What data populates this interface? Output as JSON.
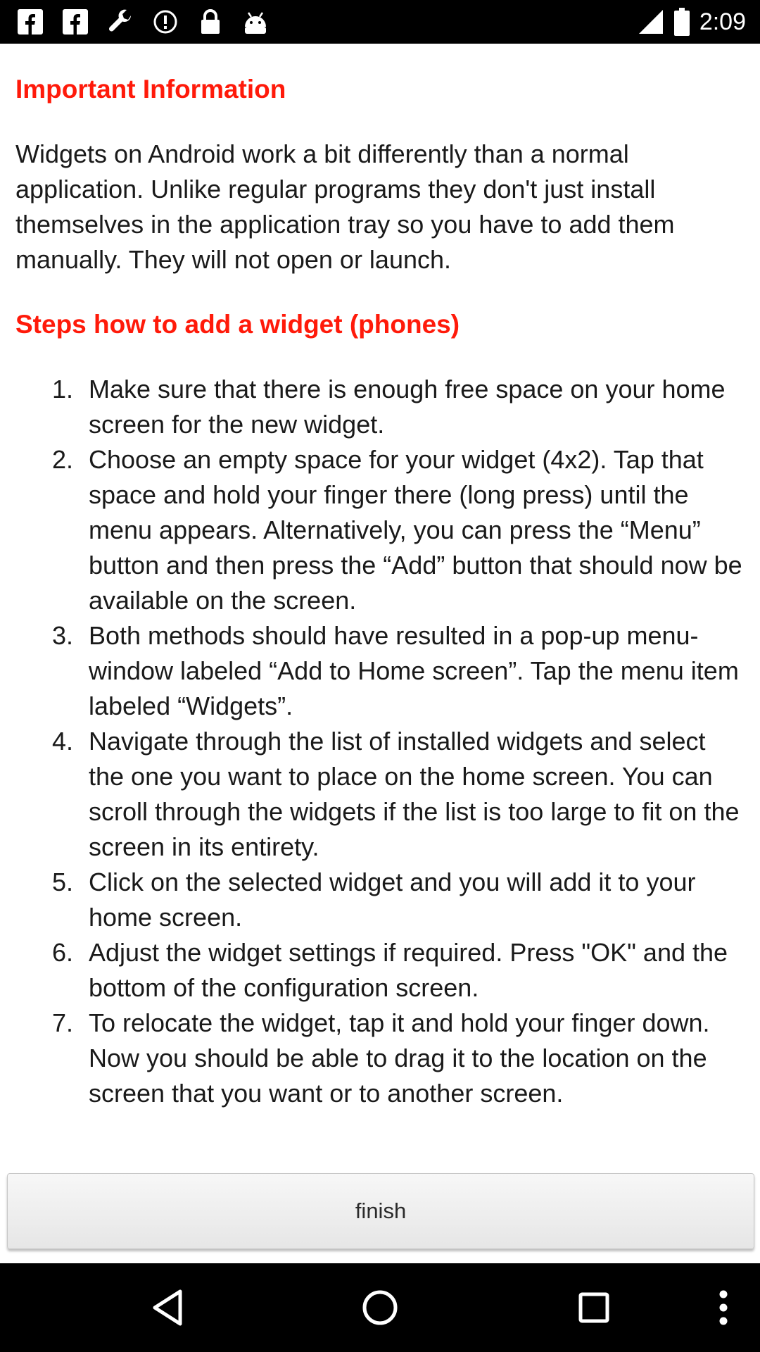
{
  "status_bar": {
    "time": "2:09",
    "icons": [
      "facebook-icon",
      "facebook-icon",
      "wrench-icon",
      "alert-circle-icon",
      "lock-icon",
      "android-icon",
      "signal-icon",
      "battery-icon"
    ]
  },
  "content": {
    "title": "Important Information",
    "intro": "Widgets on Android work a bit differently than a normal application. Unlike regular programs they don't just install themselves in the application tray so you have to add them manually. They will not open or launch.",
    "steps_heading": "Steps how to add a widget (phones)",
    "steps": [
      {
        "num": "1.",
        "text": "Make sure that there is enough free space on your home screen for the new widget."
      },
      {
        "num": "2.",
        "text": "Choose an empty space for your widget (4x2). Tap that space and hold your finger there (long press) until the menu appears. Alternatively, you can press the “Menu” button and then press the “Add” button that should now be available on the screen."
      },
      {
        "num": "3.",
        "text": "Both methods should have resulted in a pop-up menu-window labeled “Add to Home screen”. Tap the menu item labeled “Widgets”."
      },
      {
        "num": "4.",
        "text": "Navigate through the list of installed widgets and select the one you want to place on the home screen. You can scroll through the widgets if the list is too large to fit on the screen in its entirety."
      },
      {
        "num": "5.",
        "text": "Click on the selected widget and you will add it to your home screen."
      },
      {
        "num": "6.",
        "text": "Adjust the widget settings if required. Press \"OK\" and the bottom of the configuration screen."
      },
      {
        "num": "7.",
        "text": "To relocate the widget, tap it and hold your finger down. Now you should be able to drag it to the location on the screen that you want or to another screen."
      }
    ]
  },
  "finish_button": {
    "label": "finish"
  },
  "nav_bar": {
    "icons": [
      "back-icon",
      "home-icon",
      "recents-icon",
      "overflow-menu-icon"
    ]
  },
  "colors": {
    "accent_heading": "#ff1a0a",
    "status_bar": "#000000",
    "nav_bar": "#000000"
  }
}
